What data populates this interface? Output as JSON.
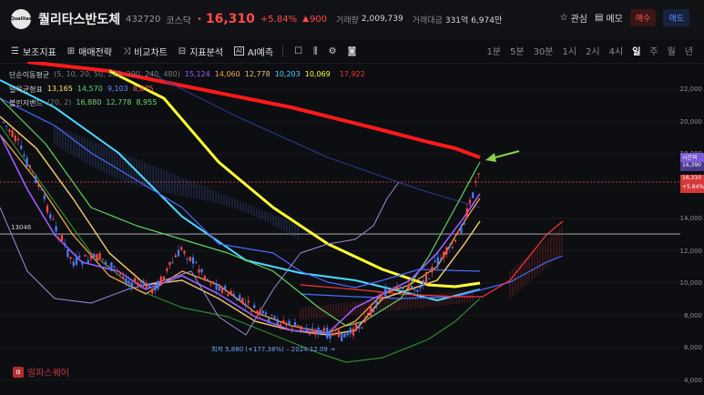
{
  "header": {
    "logo_text": "Qualitas",
    "stock_name": "퀄리타스반도체",
    "code": "432720",
    "market": "코스닥",
    "price": "16,310",
    "change_pct": "+5.84%",
    "change_abs": "900",
    "volume_label": "거래량",
    "volume_value": "2,009,739",
    "amount_label": "거래대금",
    "amount_value": "331억 6,974만"
  },
  "actions": {
    "watch_label": "관심",
    "memo_label": "메모",
    "buy_label": "매수",
    "sell_label": "매도"
  },
  "toolbar": {
    "indicator_label": "보조지표",
    "strategy_label": "매매전략",
    "compare_label": "비교차트",
    "analysis_label": "지표분석",
    "ai_label": "AI예측"
  },
  "periods": [
    "1분",
    "5분",
    "30분",
    "1시",
    "2시",
    "4시",
    "일",
    "주",
    "월",
    "년"
  ],
  "active_period": "일",
  "legend": {
    "sma_title": "단순이동평균",
    "sma_params": "(5, 10, 20, 50, 120, 200, 240, 480)",
    "sma_values": [
      "15,124",
      "14,060",
      "12,778",
      "10,203",
      "10,069",
      "",
      "17,922"
    ],
    "ichimoku_title": "일목균형표",
    "ichimoku_values": [
      "13,165",
      "14,570",
      "9,103",
      "8,875"
    ],
    "bb_title": "볼린저밴드",
    "bb_params": "(20, 2)",
    "bb_values": [
      "16,880",
      "12,778",
      "8,955"
    ]
  },
  "yaxis": [
    "22,000",
    "20,000",
    "18,000",
    "16,000",
    "14,000",
    "12,000",
    "10,000",
    "8,000",
    "6,000",
    "4,000"
  ],
  "tags": {
    "time_label": "시간외",
    "time_price": "16,390",
    "current_price": "16,310",
    "current_pct": "+5.84%"
  },
  "hline_value": "13046",
  "low_annotation": "최저 5,880 (+177.38%) – 2024.12.09 →",
  "watermark": "알파스퀘어",
  "colors": {
    "up": "#ff4a4a",
    "down": "#5b8cff",
    "ma200": "#ffff33",
    "ma480": "#ff1a1a"
  }
}
